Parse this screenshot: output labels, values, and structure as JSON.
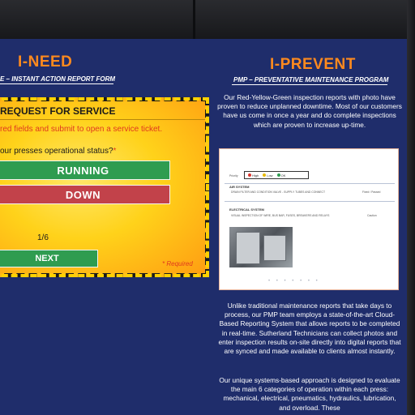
{
  "left": {
    "title": "I-NEED",
    "subtitle": "E – INSTANT ACTION REPORT FORM",
    "form": {
      "heading": "REQUEST FOR SERVICE",
      "hint": "red fields and submit to open a service ticket.",
      "question": "our presses operational status?",
      "required_star": "*",
      "running_label": "RUNNING",
      "down_label": "DOWN",
      "page_count": "1/6",
      "next_label": "NEXT",
      "required_note": "* Required"
    }
  },
  "right": {
    "title": "I-PREVENT",
    "subtitle": "PMP – PREVENTATIVE MAINTENANCE PROGRAM",
    "intro": "Our Red-Yellow-Green inspection reports with photo have proven to reduce unplanned downtime. Most of our customers have us come in once a year and do complete inspections which are proven to increase up-time.",
    "report": {
      "legend_label": "Priority",
      "legend_high": "High",
      "legend_low": "Low",
      "legend_ok": "OK",
      "section1": "AIR SYSTEM",
      "section1_text": "DRAIN FILTER AND CONDITION VALVE - SUPPLY TUBES AND CONNECT",
      "section1_status": "Fixed / Passed",
      "section2": "ELECTRICAL SYSTEM",
      "section2_text": "VISUAL INSPECTION OF WIRE, BUS BAR, FUSES, BREAKERS AND RELAYS",
      "section2_status": "Caution"
    },
    "body1": "Unlike traditional maintenance reports that take days to process, our PMP team employs a state-of-the-art Cloud-Based Reporting System that allows reports to be completed in real-time. Sutherland Technicians can collect photos and enter inspection results on-site directly into digital reports that are synced and made available to clients almost instantly.",
    "body2": "Our unique systems-based approach is designed to evaluate the main 6 categories of operation within each press: mechanical, electrical, pneumatics, hydraulics, lubrication, and overload. These"
  },
  "colors": {
    "background": "#1f2d6b",
    "accent": "#ff8a1e",
    "running": "#2f9c50",
    "down": "#c2424a",
    "required": "#e0391f"
  }
}
